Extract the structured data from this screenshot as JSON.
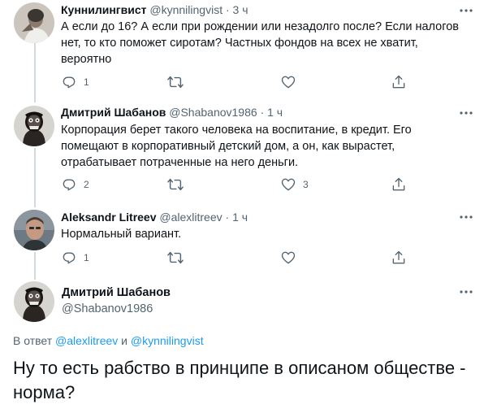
{
  "tweets": [
    {
      "name": "Куннилингвист",
      "handle": "@kynnilingvist",
      "dot": "·",
      "time": "3 ч",
      "text": "А если до 16? А если при рождении или незадолго после? Если налогов нет, то кто поможет сиротам? Частных фондов на всех не хватит, вероятно",
      "reply_count": "1",
      "retweet_count": "",
      "like_count": ""
    },
    {
      "name": "Дмитрий Шабанов",
      "handle": "@Shabanov1986",
      "dot": "·",
      "time": "1 ч",
      "text": "Корпорация берет такого человека на воспитание, в кредит. Его помещают в корпоративный детский дом, а он, как вырастет, отрабатывает потраченные на него деньги.",
      "reply_count": "2",
      "retweet_count": "",
      "like_count": "3"
    },
    {
      "name": "Aleksandr Litreev",
      "handle": "@alexlitreev",
      "dot": "·",
      "time": "1 ч",
      "text": "Нормальный вариант.",
      "reply_count": "1",
      "retweet_count": "",
      "like_count": ""
    }
  ],
  "focused": {
    "name": "Дмитрий Шабанов",
    "handle": "@Shabanov1986",
    "reply_prefix": "В ответ",
    "reply_user1": "@alexlitreev",
    "reply_and": "и",
    "reply_user2": "@kynnilingvist",
    "text": "Ну то есть рабство в принципе в описаном обществе - норма?"
  },
  "icons": {
    "reply": "reply-icon",
    "retweet": "retweet-icon",
    "like": "heart-icon",
    "share": "share-icon",
    "more": "more-icon"
  },
  "colors": {
    "accent": "#1d9bf0",
    "secondary_text": "#536471",
    "primary_text": "#0f1419",
    "thread_line": "#cfd9de"
  }
}
